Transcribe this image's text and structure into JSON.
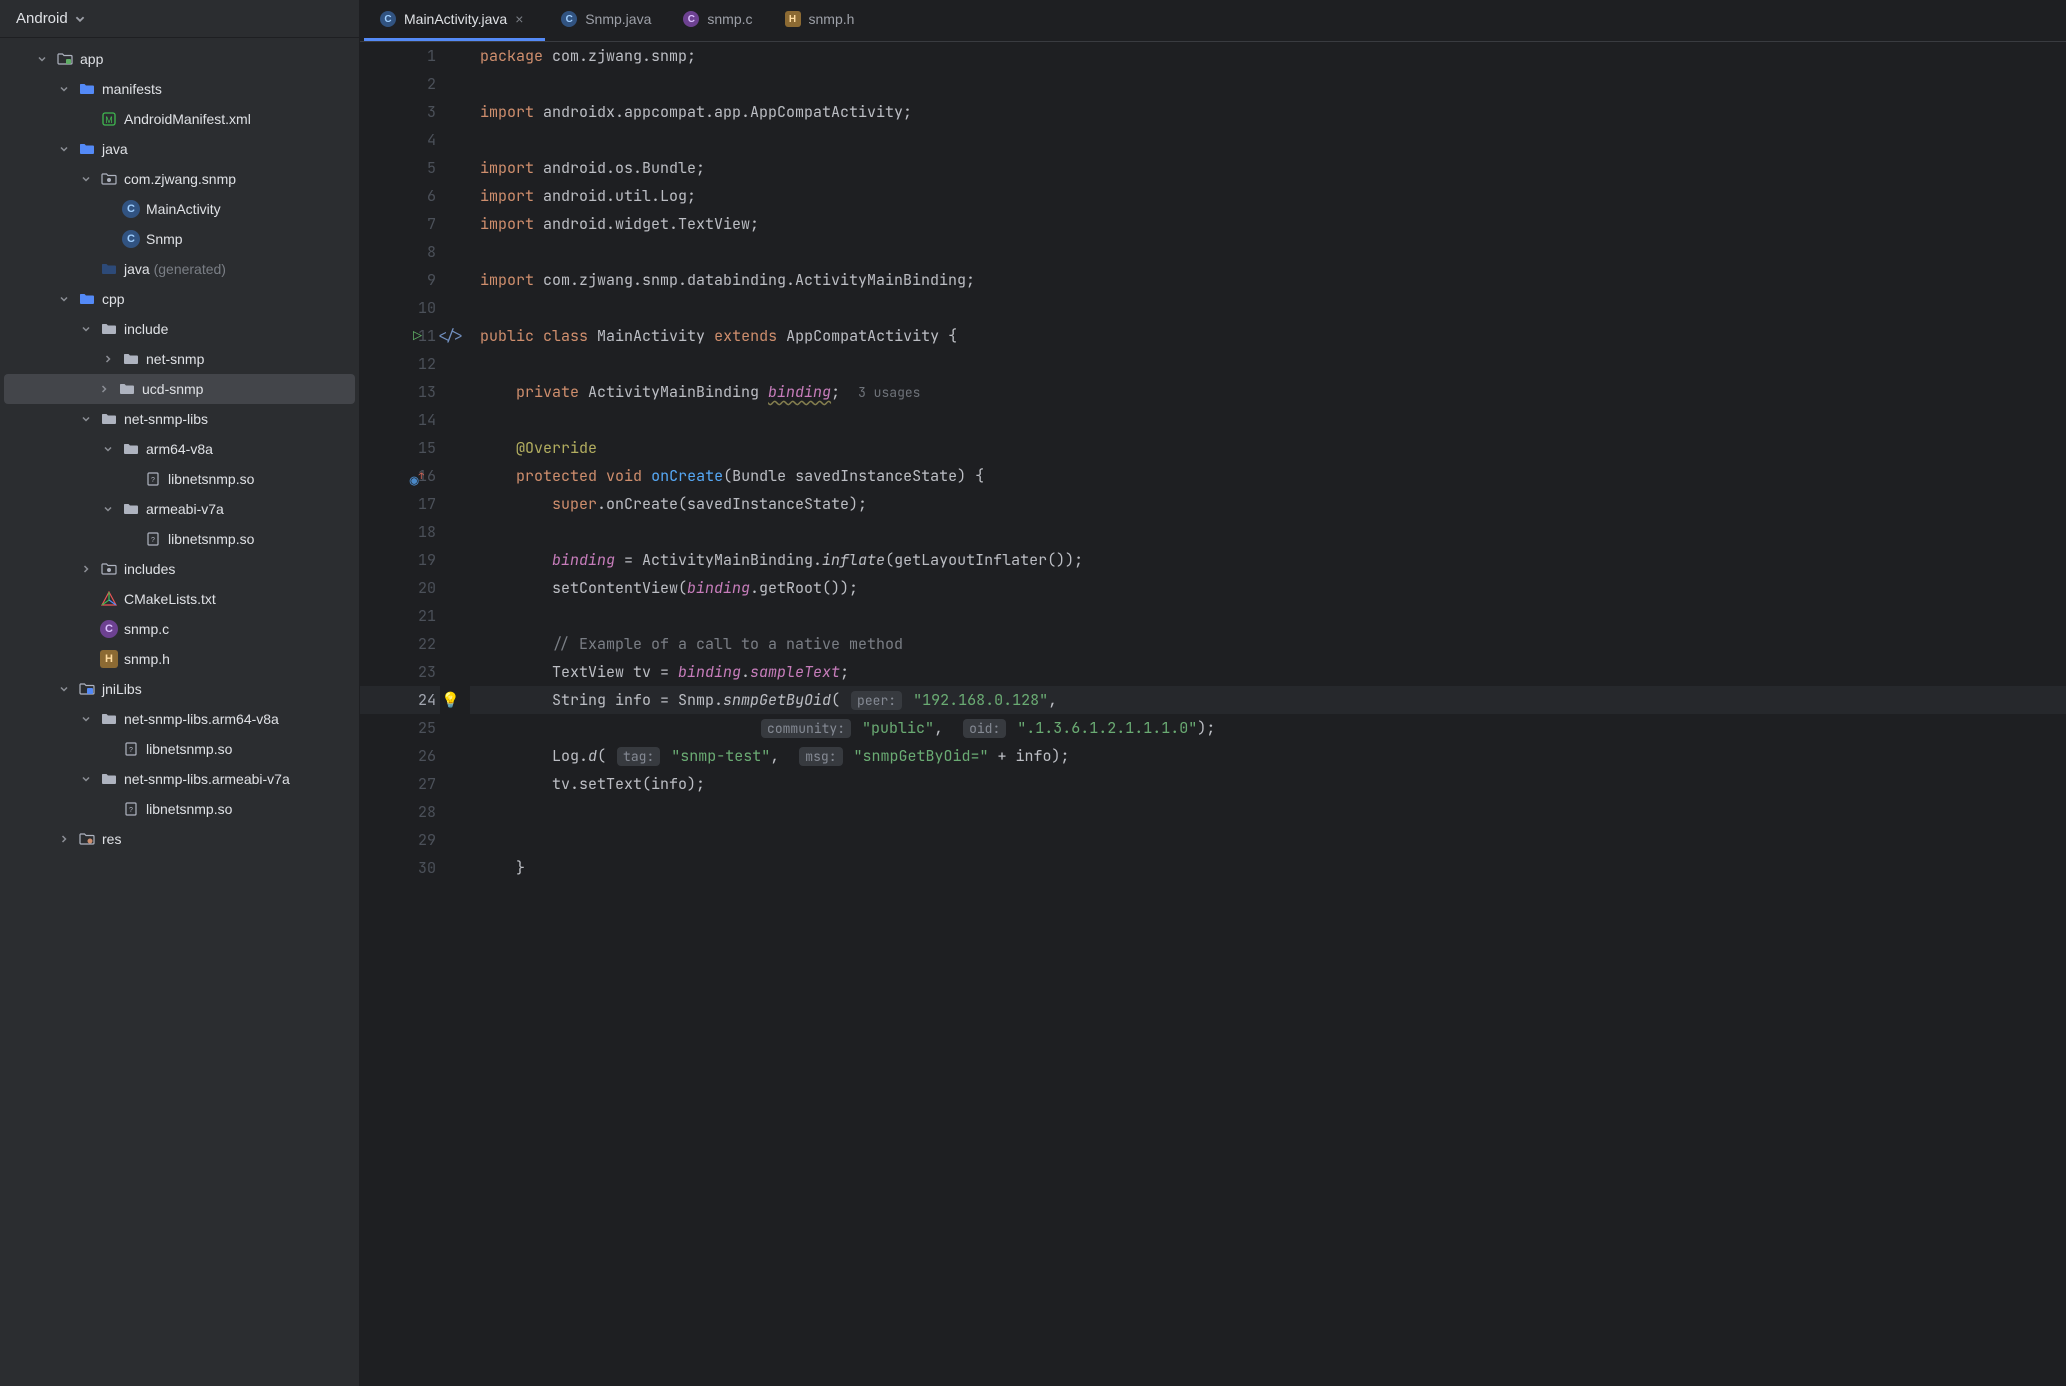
{
  "sidebar": {
    "title": "Android",
    "tree": [
      {
        "depth": 0,
        "arrow": "down",
        "icon": "module",
        "label": "app"
      },
      {
        "depth": 1,
        "arrow": "down",
        "icon": "folder",
        "label": "manifests"
      },
      {
        "depth": 2,
        "arrow": "none",
        "icon": "manifest",
        "label": "AndroidManifest.xml"
      },
      {
        "depth": 1,
        "arrow": "down",
        "icon": "folder",
        "label": "java"
      },
      {
        "depth": 2,
        "arrow": "down",
        "icon": "pkg",
        "label": "com.zjwang.snmp"
      },
      {
        "depth": 3,
        "arrow": "none",
        "icon": "class",
        "label": "MainActivity"
      },
      {
        "depth": 3,
        "arrow": "none",
        "icon": "class",
        "label": "Snmp"
      },
      {
        "depth": 2,
        "arrow": "none",
        "icon": "folder-gen",
        "label": "java",
        "suffix": "(generated)"
      },
      {
        "depth": 1,
        "arrow": "down",
        "icon": "folder",
        "label": "cpp"
      },
      {
        "depth": 2,
        "arrow": "down",
        "icon": "folder-plain",
        "label": "include"
      },
      {
        "depth": 3,
        "arrow": "right",
        "icon": "folder-plain",
        "label": "net-snmp"
      },
      {
        "depth": 3,
        "arrow": "right",
        "icon": "folder-plain",
        "label": "ucd-snmp",
        "selected": true
      },
      {
        "depth": 2,
        "arrow": "down",
        "icon": "folder-plain",
        "label": "net-snmp-libs"
      },
      {
        "depth": 3,
        "arrow": "down",
        "icon": "folder-plain",
        "label": "arm64-v8a"
      },
      {
        "depth": 4,
        "arrow": "none",
        "icon": "so",
        "label": "libnetsnmp.so"
      },
      {
        "depth": 3,
        "arrow": "down",
        "icon": "folder-plain",
        "label": "armeabi-v7a"
      },
      {
        "depth": 4,
        "arrow": "none",
        "icon": "so",
        "label": "libnetsnmp.so"
      },
      {
        "depth": 2,
        "arrow": "right",
        "icon": "pkg",
        "label": "includes"
      },
      {
        "depth": 2,
        "arrow": "none",
        "icon": "cmake",
        "label": "CMakeLists.txt"
      },
      {
        "depth": 2,
        "arrow": "none",
        "icon": "c",
        "label": "snmp.c"
      },
      {
        "depth": 2,
        "arrow": "none",
        "icon": "h",
        "label": "snmp.h"
      },
      {
        "depth": 1,
        "arrow": "down",
        "icon": "jnilibs",
        "label": "jniLibs"
      },
      {
        "depth": 2,
        "arrow": "down",
        "icon": "folder-plain",
        "label": "net-snmp-libs.arm64-v8a"
      },
      {
        "depth": 3,
        "arrow": "none",
        "icon": "so",
        "label": "libnetsnmp.so"
      },
      {
        "depth": 2,
        "arrow": "down",
        "icon": "folder-plain",
        "label": "net-snmp-libs.armeabi-v7a"
      },
      {
        "depth": 3,
        "arrow": "none",
        "icon": "so",
        "label": "libnetsnmp.so"
      },
      {
        "depth": 1,
        "arrow": "right",
        "icon": "res",
        "label": "res"
      }
    ]
  },
  "tabs": [
    {
      "icon": "java",
      "label": "MainActivity.java",
      "active": true,
      "close": true
    },
    {
      "icon": "java",
      "label": "Snmp.java"
    },
    {
      "icon": "c",
      "label": "snmp.c"
    },
    {
      "icon": "h",
      "label": "snmp.h"
    }
  ],
  "code": {
    "numbers": [
      "1",
      "2",
      "3",
      "4",
      "5",
      "6",
      "7",
      "8",
      "9",
      "10",
      "11",
      "12",
      "13",
      "14",
      "15",
      "16",
      "17",
      "18",
      "19",
      "20",
      "21",
      "22",
      "23",
      "24",
      "25",
      "26",
      "27",
      "28",
      "29",
      "30"
    ],
    "highlight_line": 24,
    "run_line": 11,
    "override_line": 16,
    "bulb_line": 24,
    "usages_hint": "3 usages",
    "param_hint_peer": "peer:",
    "param_hint_community": "community:",
    "param_hint_oid": "oid:",
    "param_hint_tag": "tag:",
    "param_hint_msg": "msg:",
    "tokens": {
      "package": "package",
      "import": "import",
      "public": "public",
      "class": "class",
      "extends": "extends",
      "private": "private",
      "protected": "protected",
      "void": "void",
      "super": "super",
      "pkg_name": "com.zjwang.snmp",
      "imp1": "androidx.appcompat.app.AppCompatActivity",
      "imp2": "android.os.Bundle",
      "imp3": "android.util.Log",
      "imp4": "android.widget.TextView",
      "imp5": "com.zjwang.snmp.databinding.ActivityMainBinding",
      "cls": "MainActivity",
      "sup": "AppCompatActivity",
      "bindingType": "ActivityMainBinding",
      "bindingField": "binding",
      "override": "@Override",
      "onCreate": "onCreate",
      "Bundle": "Bundle",
      "saved": "savedInstanceState",
      "inflate": "inflate",
      "getLayoutInflater": "getLayoutInflater",
      "setContentView": "setContentView",
      "getRoot": "getRoot",
      "comment": "// Example of a call to a native method",
      "TextView": "TextView",
      "tv": "tv",
      "sampleText": "sampleText",
      "String": "String",
      "info": "info",
      "Snmp": "Snmp",
      "snmpGetByOid": "snmpGetByOid",
      "ip": "\"192.168.0.128\"",
      "pub": "\"public\"",
      "oid": "\".1.3.6.1.2.1.1.1.0\"",
      "Log": "Log",
      "d": "d",
      "tagval": "\"snmp-test\"",
      "msgval": "\"snmpGetByOid=\"",
      "setText": "setText"
    }
  }
}
